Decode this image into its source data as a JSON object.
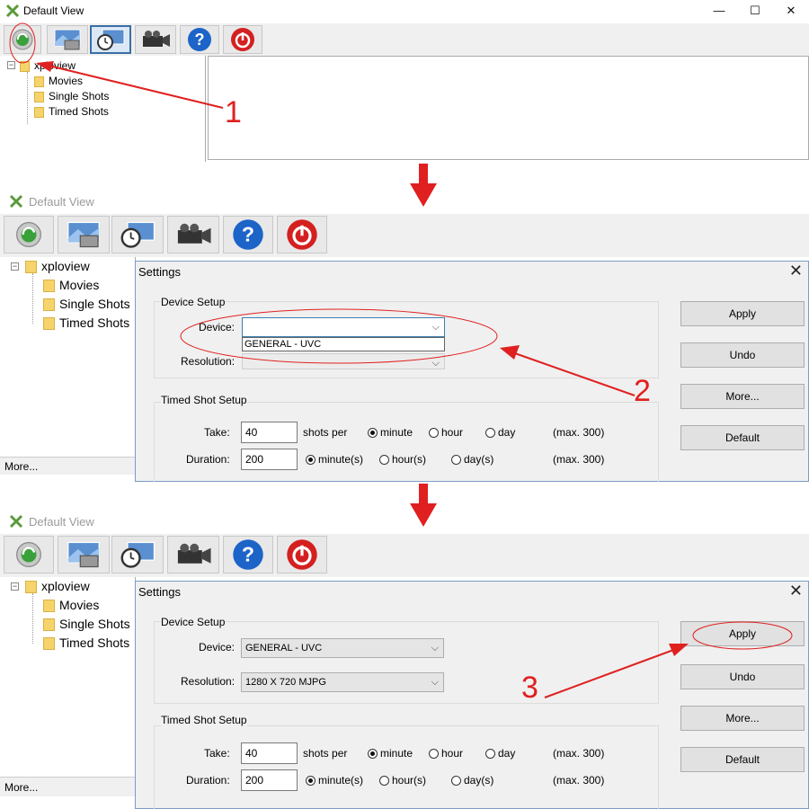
{
  "window": {
    "title": "Default View",
    "controls": {
      "minimize": "—",
      "maximize": "☐",
      "close": "✕"
    }
  },
  "toolbar": {
    "buttons": [
      {
        "icon": "refresh-gear-icon"
      },
      {
        "icon": "photo-camera-icon"
      },
      {
        "icon": "timer-photo-icon"
      },
      {
        "icon": "video-camera-icon"
      },
      {
        "icon": "help-icon"
      },
      {
        "icon": "power-icon"
      }
    ]
  },
  "tree": {
    "root": "xploview",
    "children": [
      "Movies",
      "Single Shots",
      "Timed Shots"
    ],
    "more": "More..."
  },
  "settings": {
    "title": "Settings",
    "close": "✕",
    "device_setup": {
      "label": "Device Setup",
      "device_label": "Device:",
      "resolution_label": "Resolution:",
      "device_option": "GENERAL - UVC",
      "device_value": "GENERAL - UVC",
      "resolution_value": "1280 X 720 MJPG"
    },
    "timed_setup": {
      "label": "Timed Shot Setup",
      "take_label": "Take:",
      "take_value": "40",
      "shots_per": "shots per",
      "take_options": [
        "minute",
        "hour",
        "day"
      ],
      "max_take": "(max. 300)",
      "duration_label": "Duration:",
      "duration_value": "200",
      "duration_options": [
        "minute(s)",
        "hour(s)",
        "day(s)"
      ],
      "max_duration": "(max. 300)"
    },
    "buttons": {
      "apply": "Apply",
      "undo": "Undo",
      "more": "More...",
      "default": "Default"
    }
  },
  "annotations": {
    "step1": "1",
    "step2": "2",
    "step3": "3"
  },
  "colors": {
    "annotation": "#e02020",
    "accent": "#3c7fb1"
  }
}
